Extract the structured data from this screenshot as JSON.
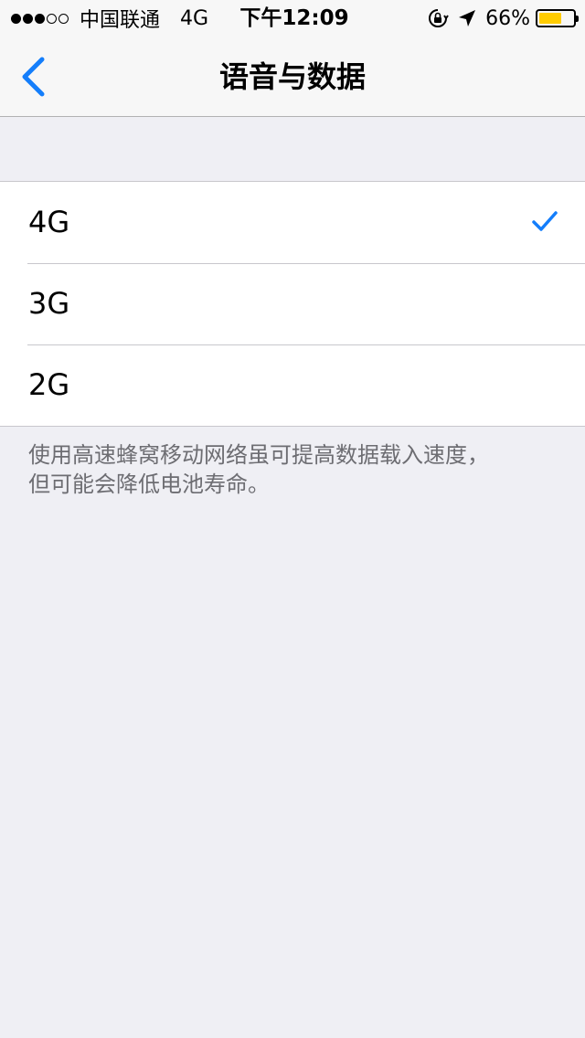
{
  "status_bar": {
    "signal_dots_filled": 3,
    "signal_dots_total": 5,
    "carrier": "中国联通",
    "network": "4G",
    "time": "下午12:09",
    "icons": [
      "orientation-lock-icon",
      "location-arrow-icon"
    ],
    "battery_percent_text": "66%",
    "battery_level": 0.66,
    "battery_color": "#ffcc00"
  },
  "nav": {
    "title": "语音与数据",
    "back_icon": "chevron-left-icon",
    "accent_color": "#147efb"
  },
  "options": [
    {
      "label": "4G",
      "selected": true
    },
    {
      "label": "3G",
      "selected": false
    },
    {
      "label": "2G",
      "selected": false
    }
  ],
  "footer": {
    "line1": "使用高速蜂窝移动网络虽可提高数据载入速度，",
    "line2": "但可能会降低电池寿命。"
  }
}
